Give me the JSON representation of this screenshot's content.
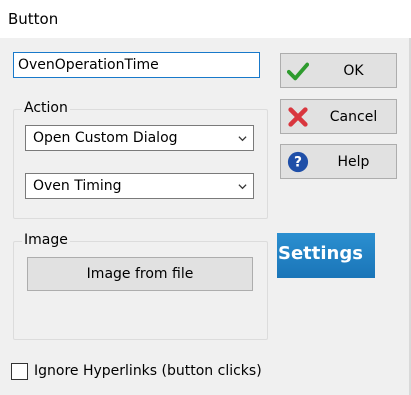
{
  "window": {
    "title": "Button"
  },
  "name_field": {
    "value": "OvenOperationTime"
  },
  "action_group": {
    "label": "Action",
    "action_select": "Open Custom Dialog",
    "dialog_select": "Oven Timing"
  },
  "image_group": {
    "label": "Image",
    "image_button": "Image from file"
  },
  "buttons": {
    "ok": "OK",
    "cancel": "Cancel",
    "help": "Help"
  },
  "settings_button": {
    "label": "Settings"
  },
  "ignore_hyperlinks": {
    "label": "Ignore Hyperlinks (button clicks)",
    "checked": false
  },
  "icons": {
    "ok": "checkmark-icon",
    "cancel": "cross-icon",
    "help": "question-icon"
  },
  "colors": {
    "ok_green": "#2e9b2e",
    "cancel_red": "#d9363e",
    "help_blue": "#1f4fa8",
    "settings_blue": "#1a75b8"
  }
}
